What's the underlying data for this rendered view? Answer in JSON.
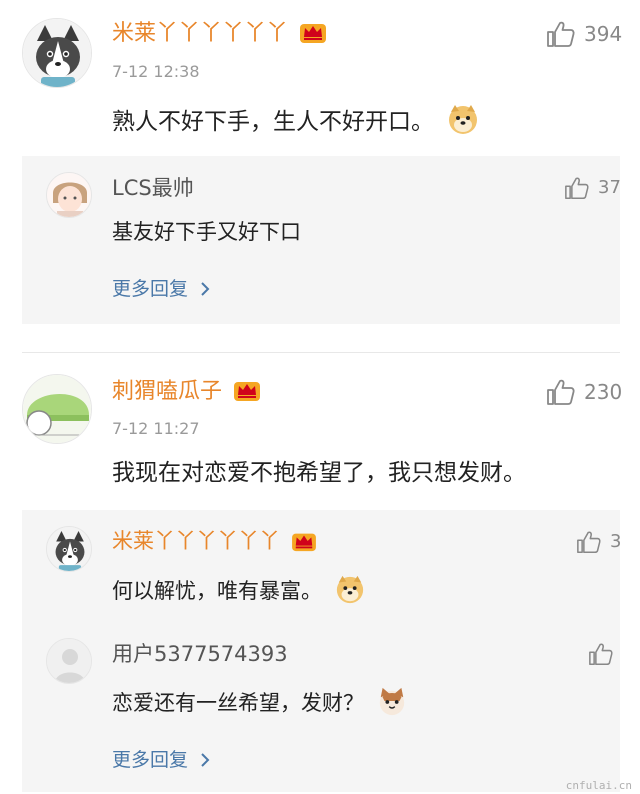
{
  "comments": [
    {
      "username": "米莱丫丫丫丫丫丫",
      "time": "7-12 12:38",
      "text": "熟人不好下手，生人不好开口。",
      "likes": "394",
      "avatar": "husky-avatar",
      "replies": [
        {
          "username": "LCS最帅",
          "text": "基友好下手又好下口",
          "likes": "37",
          "avatar": "anime-avatar"
        }
      ],
      "more_replies": "更多回复"
    },
    {
      "username": "刺猬嗑瓜子",
      "time": "7-12 11:27",
      "text": "我现在对恋爱不抱希望了，我只想发财。",
      "likes": "230",
      "avatar": "green-helmet-avatar",
      "replies": [
        {
          "username": "米莱丫丫丫丫丫丫",
          "text": "何以解忧，唯有暴富。",
          "likes": "3",
          "avatar": "husky-avatar"
        },
        {
          "username": "用户5377574393",
          "text": "恋爱还有一丝希望，发财？",
          "likes": "",
          "avatar": "default-avatar"
        }
      ],
      "more_replies": "更多回复"
    }
  ],
  "watermark": "cnfulai.cn",
  "colors": {
    "vip_name": "#e8862b",
    "link": "#4a78a8",
    "reply_bg": "#f5f5f5",
    "muted": "#9a9a9a"
  }
}
